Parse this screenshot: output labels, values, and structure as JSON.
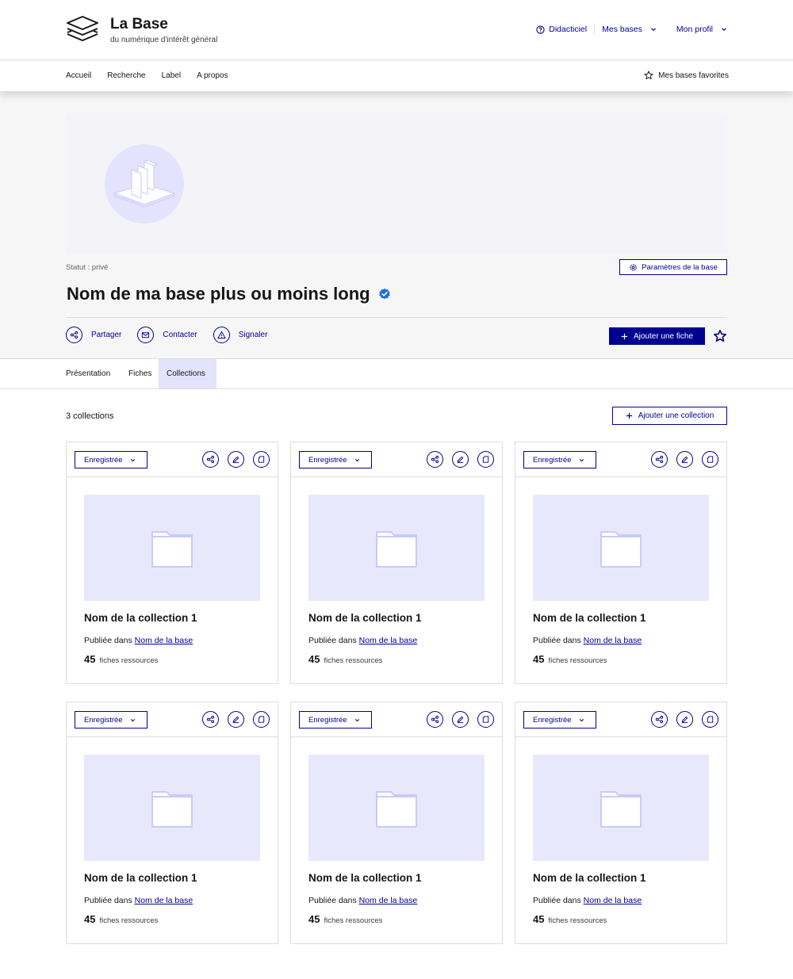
{
  "header": {
    "brand_title": "La Base",
    "brand_subtitle": "du numérique d'intérêt général",
    "links": [
      "Didacticiel",
      "Mes bases",
      "Mon profil"
    ]
  },
  "nav": {
    "items": [
      "Accueil",
      "Recherche",
      "Label",
      "A propos"
    ],
    "favorites": "Mes bases favorites"
  },
  "base": {
    "statut": "Statut : privé",
    "settings_button": "Paramètres de la base",
    "title": "Nom de ma base plus ou moins long",
    "actions": [
      "Partager",
      "Contacter",
      "Signaler"
    ],
    "add_fiche": "Ajouter une fiche"
  },
  "tabs": [
    "Présentation",
    "Fiches",
    "Collections"
  ],
  "active_tab": "Collections",
  "collections": {
    "count_label": "3 collections",
    "add_button": "Ajouter une collection",
    "cards": [
      {
        "saved_label": "Enregistrée",
        "name": "Nom de la collection 1",
        "published_prefix": "Publiée dans",
        "base_link": "Nom de la base",
        "count": "45",
        "count_label": "fiches ressources"
      },
      {
        "saved_label": "Enregistrée",
        "name": "Nom de la collection 1",
        "published_prefix": "Publiée dans",
        "base_link": "Nom de la base",
        "count": "45",
        "count_label": "fiches ressources"
      },
      {
        "saved_label": "Enregistrée",
        "name": "Nom de la collection 1",
        "published_prefix": "Publiée dans",
        "base_link": "Nom de la base",
        "count": "45",
        "count_label": "fiches ressources"
      },
      {
        "saved_label": "Enregistrée",
        "name": "Nom de la collection 1",
        "published_prefix": "Publiée dans",
        "base_link": "Nom de la base",
        "count": "45",
        "count_label": "fiches ressources"
      },
      {
        "saved_label": "Enregistrée",
        "name": "Nom de la collection 1",
        "published_prefix": "Publiée dans",
        "base_link": "Nom de la base",
        "count": "45",
        "count_label": "fiches ressources"
      },
      {
        "saved_label": "Enregistrée",
        "name": "Nom de la collection 1",
        "published_prefix": "Publiée dans",
        "base_link": "Nom de la base",
        "count": "45",
        "count_label": "fiches ressources"
      }
    ]
  },
  "colors": {
    "primary": "#000091",
    "hero_bg": "#f6f6f6",
    "accent_light": "#e3e3fd",
    "verified": "#1d6fe0"
  }
}
